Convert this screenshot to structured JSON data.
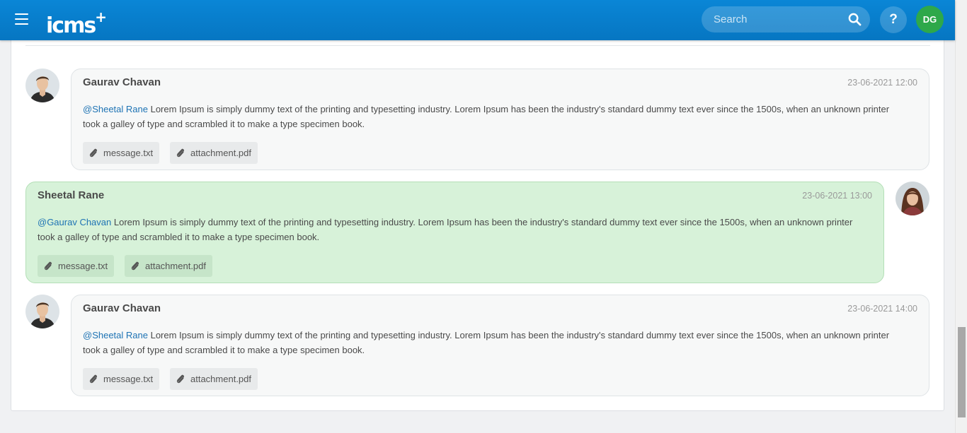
{
  "header": {
    "logo": "icms",
    "logo_plus": "+",
    "search_placeholder": "Search",
    "help_label": "?",
    "user_initials": "DG"
  },
  "messages": [
    {
      "sender": "Gaurav Chavan",
      "timestamp": "23-06-2021 12:00",
      "mention": "@Sheetal Rane",
      "body": " Lorem Ipsum is simply dummy text of the printing and typesetting industry. Lorem Ipsum has been the industry's standard dummy text ever since the 1500s, when an unknown printer took a galley of type and scrambled it to make a type specimen book.",
      "attachments": [
        "message.txt",
        "attachment.pdf"
      ]
    },
    {
      "sender": "Sheetal Rane",
      "timestamp": "23-06-2021 13:00",
      "mention": "@Gaurav Chavan",
      "body": " Lorem Ipsum is simply dummy text of the printing and typesetting industry. Lorem Ipsum has been the industry's standard dummy text ever since the 1500s, when an unknown printer took a galley of type and scrambled it to make a type specimen book.",
      "attachments": [
        "message.txt",
        "attachment.pdf"
      ]
    },
    {
      "sender": "Gaurav Chavan",
      "timestamp": "23-06-2021 14:00",
      "mention": "@Sheetal Rane",
      "body": " Lorem Ipsum is simply dummy text of the printing and typesetting industry. Lorem Ipsum has been the industry's standard dummy text ever since the 1500s, when an unknown printer took a galley of type and scrambled it to make a type specimen book.",
      "attachments": [
        "message.txt",
        "attachment.pdf"
      ]
    }
  ],
  "icons": {
    "menu": "hamburger-menu-icon",
    "search": "search-icon",
    "attachment": "paperclip-icon"
  },
  "colors": {
    "header": "#0a86d6",
    "own_bubble": "#d7f2d9",
    "other_bubble": "#f7f8f8",
    "avatar": "#2ea84a",
    "mention": "#1e73b4"
  }
}
